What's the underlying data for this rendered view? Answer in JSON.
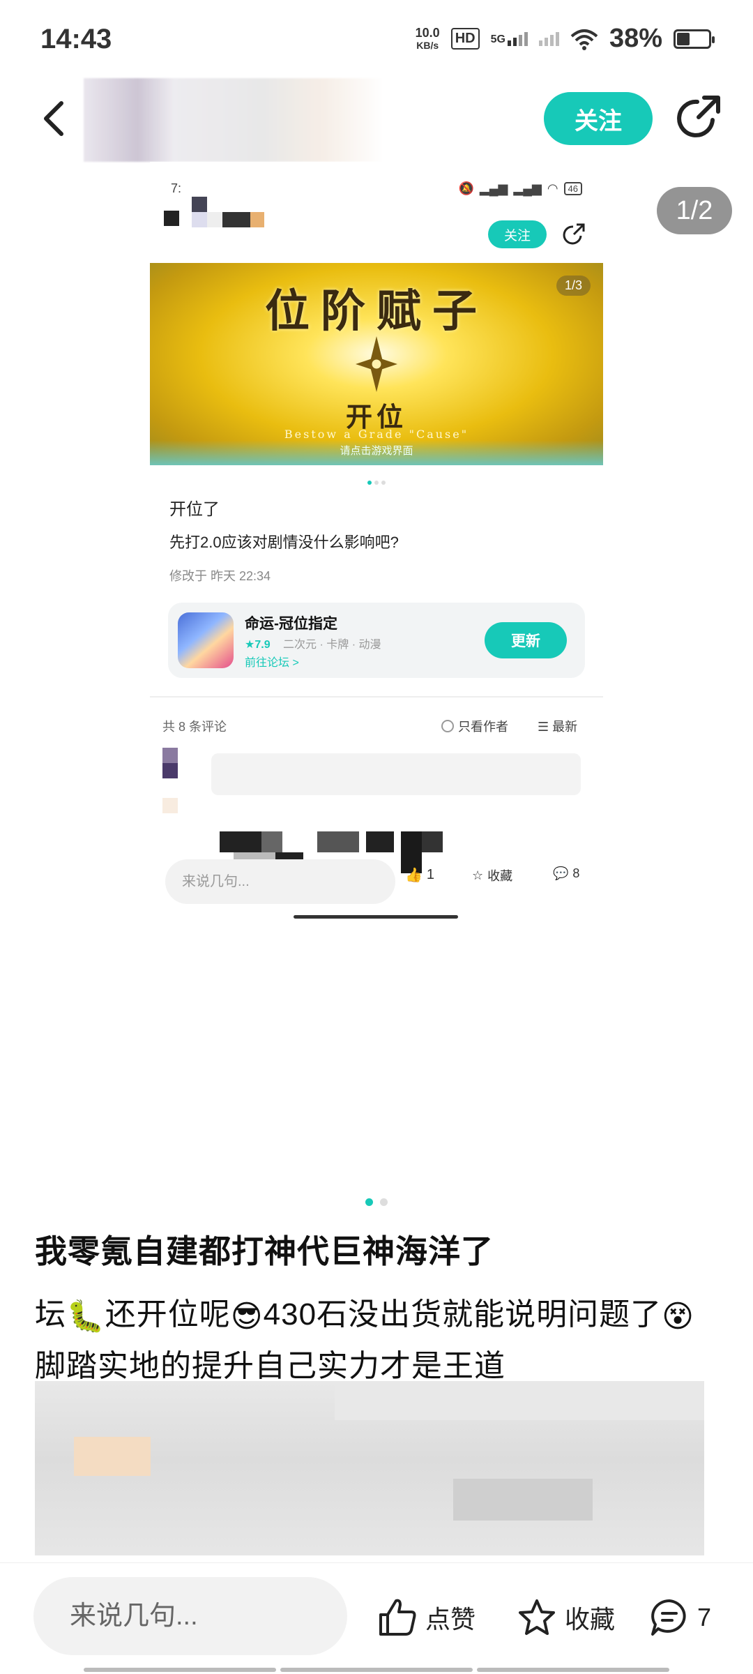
{
  "status_bar": {
    "time": "14:43",
    "net_speed_value": "10.0",
    "net_speed_unit": "KB/s",
    "hd": "HD",
    "net_type": "5G",
    "battery": "38%"
  },
  "header": {
    "follow_label": "关注"
  },
  "carousel": {
    "page_indicator": "1/2",
    "active_index": 0,
    "count": 2
  },
  "inner_post": {
    "status_time": "7:",
    "battery": "46",
    "follow_label": "关注",
    "banner": {
      "title": "位阶赋子",
      "subtitle": "开位",
      "english": "Bestow a Grade \"Cause\"",
      "hint": "请点击游戏界面",
      "count": "1/3"
    },
    "title": "开位了",
    "body": "先打2.0应该对剧情没什么影响吧?",
    "meta": "修改于 昨天 22:34",
    "game_card": {
      "name": "命运-冠位指定",
      "rating": "★7.9",
      "tags": "二次元 · 卡牌 · 动漫",
      "forum_link": "前往论坛 >",
      "button": "更新"
    },
    "comments_count": "共 8 条评论",
    "only_author": "只看作者",
    "sort": "最新",
    "input_placeholder": "来说几句...",
    "likes": "1",
    "favorite": "收藏",
    "comments": "8"
  },
  "post": {
    "title": "我零氪自建都打神代巨神海洋了",
    "line1_a": "坛",
    "line1_b": "还开位呢",
    "line1_c": "430石没出货就能说明问题了",
    "line2": "脚踏实地的提升自己实力才是王道"
  },
  "bottom_bar": {
    "input_placeholder": "来说几句...",
    "like_label": "点赞",
    "favorite_label": "收藏",
    "comment_count": "7"
  },
  "colors": {
    "accent": "#17c9b8"
  }
}
